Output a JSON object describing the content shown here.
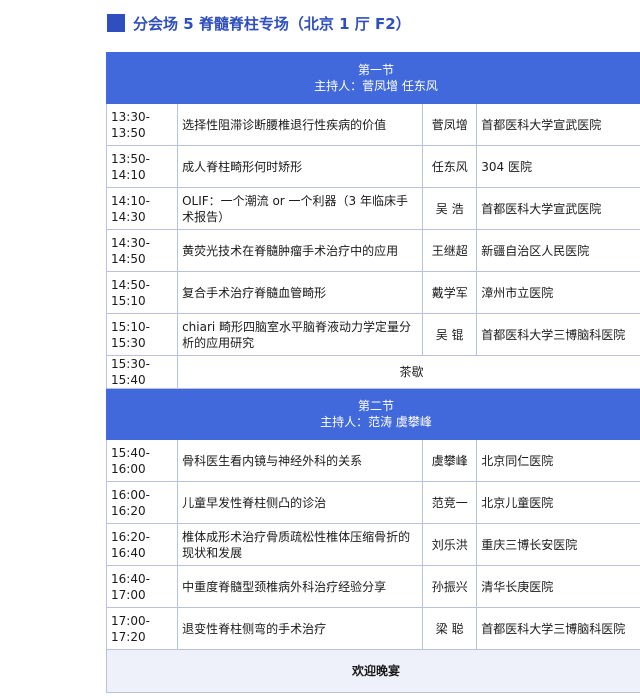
{
  "header": {
    "title": "分会场 5   脊髓脊柱专场（北京 1 厅   F2）",
    "accent_color": "#2f4fbf"
  },
  "sessions": [
    {
      "name": "第一节",
      "hosts": "主持人：菅凤增   任东风",
      "talks": [
        {
          "time": "13:30-13:50",
          "topic": "选择性阻滞诊断腰椎退行性疾病的价值",
          "speaker": "菅凤增",
          "institution": "首都医科大学宣武医院"
        },
        {
          "time": "13:50-14:10",
          "topic": "成人脊柱畸形何时矫形",
          "speaker": "任东风",
          "institution": "304 医院"
        },
        {
          "time": "14:10-14:30",
          "topic": "OLIF：一个潮流 or 一个利器（3 年临床手术报告）",
          "speaker": "吴   浩",
          "institution": "首都医科大学宣武医院"
        },
        {
          "time": "14:30-14:50",
          "topic": "黄荧光技术在脊髓肿瘤手术治疗中的应用",
          "speaker": "王继超",
          "institution": "新疆自治区人民医院"
        },
        {
          "time": "14:50-15:10",
          "topic": "复合手术治疗脊髓血管畸形",
          "speaker": "戴学军",
          "institution": "漳州市立医院"
        },
        {
          "time": "15:10-15:30",
          "topic": "chiari 畸形四脑室水平脑脊液动力学定量分析的应用研究",
          "speaker": "吴   锟",
          "institution": "首都医科大学三博脑科医院"
        }
      ],
      "break": {
        "time": "15:30-15:40",
        "label": "茶歇"
      }
    },
    {
      "name": "第二节",
      "hosts": "主持人：范涛   虞攀峰",
      "talks": [
        {
          "time": "15:40-16:00",
          "topic": "骨科医生看内镜与神经外科的关系",
          "speaker": "虞攀峰",
          "institution": "北京同仁医院"
        },
        {
          "time": "16:00-16:20",
          "topic": "儿童早发性脊柱侧凸的诊治",
          "speaker": "范竞一",
          "institution": "北京儿童医院"
        },
        {
          "time": "16:20-16:40",
          "topic": "椎体成形术治疗骨质疏松性椎体压缩骨折的现状和发展",
          "speaker": "刘乐洪",
          "institution": "重庆三博长安医院"
        },
        {
          "time": "16:40-17:00",
          "topic": "中重度脊髓型颈椎病外科治疗经验分享",
          "speaker": "孙振兴",
          "institution": "清华长庚医院"
        },
        {
          "time": "17:00-17:20",
          "topic": "退变性脊柱侧弯的手术治疗",
          "speaker": "梁   聪",
          "institution": "首都医科大学三博脑科医院"
        }
      ]
    }
  ],
  "closing": {
    "label": "欢迎晚宴"
  }
}
